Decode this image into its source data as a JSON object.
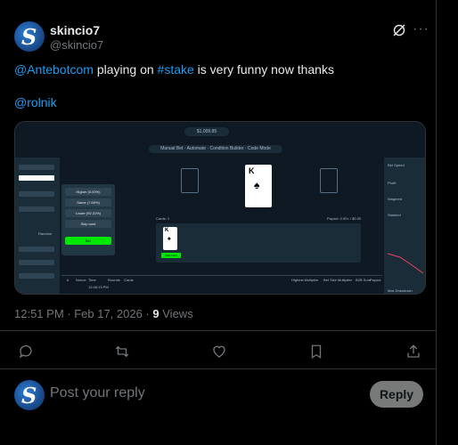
{
  "author": {
    "display_name": "skincio7",
    "handle": "@skincio7",
    "avatar_letter": "S"
  },
  "tweet": {
    "mention1": "@Antebotcom",
    "text1": "playing on",
    "hashtag": "#stake",
    "text2": "is very funny now thanks",
    "mention2": "@rolnik"
  },
  "meta": {
    "time": "12:51 PM · Feb 17, 2026 ·",
    "views_count": "9",
    "views_label": "Views"
  },
  "reply": {
    "placeholder": "Post your reply",
    "button": "Reply"
  },
  "icons": {
    "grok": "grok-icon",
    "more": "more-icon",
    "comment": "comment-icon",
    "retweet": "retweet-icon",
    "like": "heart-icon",
    "bookmark": "bookmark-icon",
    "share": "share-icon"
  },
  "media_screenshot": {
    "balance": "$1,009.85",
    "tabs": [
      "Manual Bet",
      "Automate",
      "Condition Builder",
      "Code Mode"
    ],
    "options": [
      "Higher (0.00%)",
      "Same (7.69%)",
      "Lower (92.31%)",
      "Skip card"
    ],
    "bet_label": "Bet",
    "big_card_rank": "K",
    "small_card_rank": "K",
    "start_card_label": "Start Card",
    "cards_label": "Cards: 1",
    "payout_label": "Payout: 0.00× / $0.00",
    "right_stats": [
      "Bet Speed",
      "Profit",
      "Wagered",
      "Stashed"
    ],
    "left_labels": [
      "Random"
    ],
    "history_header": [
      "#",
      "Nonce",
      "Time",
      "Rounds",
      "Cards",
      "Highest Multiplier",
      "Bet Size",
      "Multiplier",
      "B2B Sum",
      "Payout"
    ],
    "history_row_time": "12:48:13 PM",
    "max_drawdown_label": "Max Drawdown"
  }
}
